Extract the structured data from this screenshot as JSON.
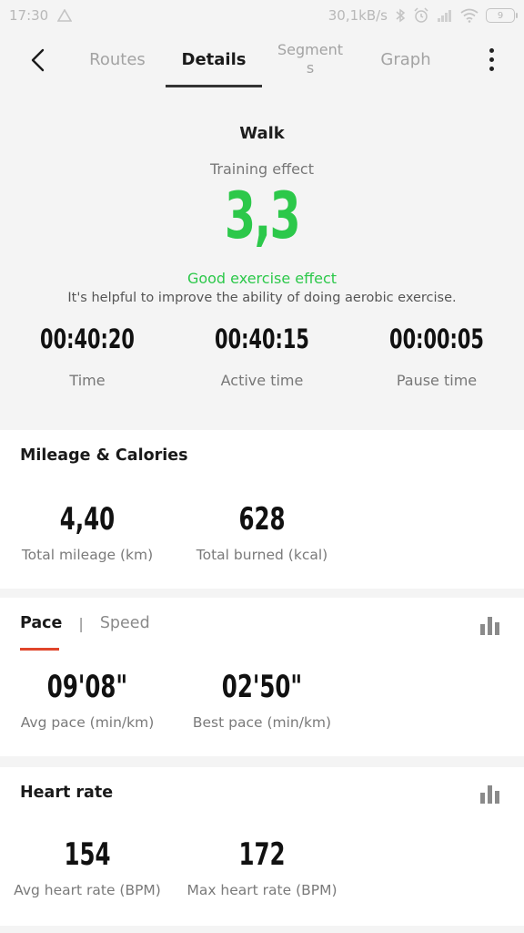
{
  "status": {
    "time": "17:30",
    "net_speed": "30,1kB/s",
    "battery": "9"
  },
  "nav": {
    "tabs": [
      {
        "label": "Routes"
      },
      {
        "label": "Details"
      },
      {
        "label": "Segments"
      },
      {
        "label": "Graph"
      }
    ],
    "active_tab": "Details"
  },
  "summary": {
    "activity": "Walk",
    "training_effect_label": "Training effect",
    "training_effect_value": "3,3",
    "effect_title": "Good exercise effect",
    "effect_desc": "It's helpful to improve the ability of doing aerobic exercise.",
    "times": [
      {
        "value": "00:40:20",
        "label": "Time"
      },
      {
        "value": "00:40:15",
        "label": "Active time"
      },
      {
        "value": "00:00:05",
        "label": "Pause time"
      }
    ]
  },
  "mileage": {
    "title": "Mileage & Calories",
    "stats": [
      {
        "value": "4,40",
        "label": "Total mileage (km)"
      },
      {
        "value": "628",
        "label": "Total burned (kcal)"
      }
    ]
  },
  "pace": {
    "tab_active": "Pace",
    "tab_other": "Speed",
    "stats": [
      {
        "value": "09'08\"",
        "label": "Avg pace (min/km)"
      },
      {
        "value": "02'50\"",
        "label": "Best pace (min/km)"
      }
    ]
  },
  "heart_rate": {
    "title": "Heart rate",
    "stats": [
      {
        "value": "154",
        "label": "Avg heart rate (BPM)"
      },
      {
        "value": "172",
        "label": "Max heart rate (BPM)"
      }
    ]
  },
  "colors": {
    "accent_green": "#2cc84a",
    "pace_underline": "#e0452b"
  }
}
